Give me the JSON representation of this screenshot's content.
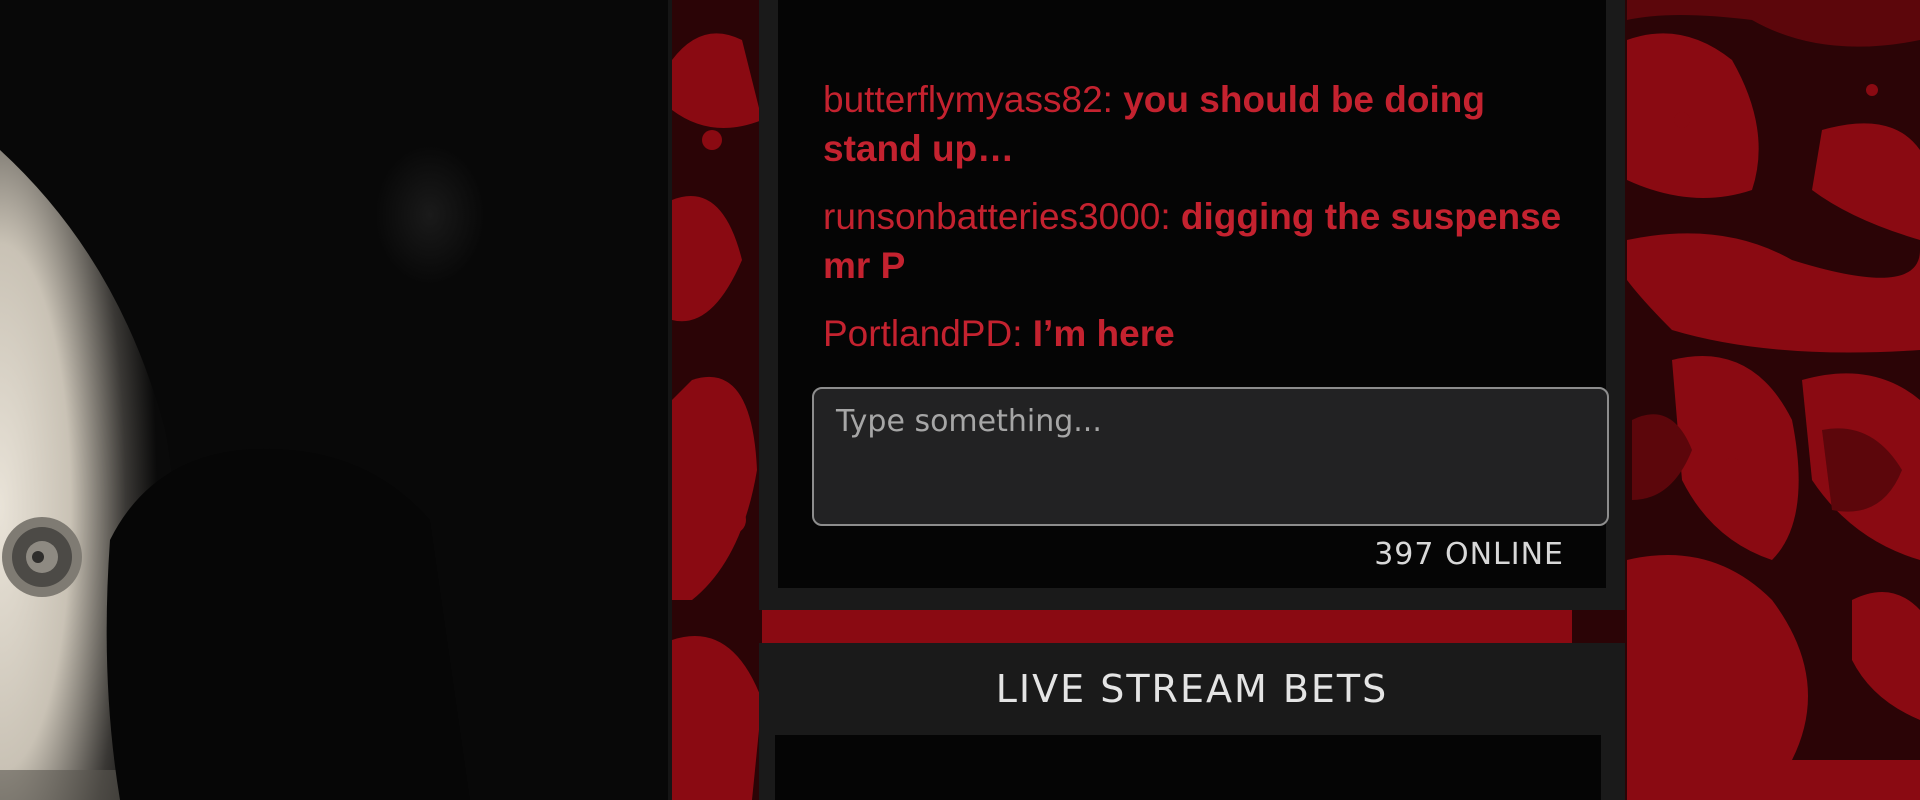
{
  "chat": {
    "messages": [
      {
        "user": "butterflymyass82:",
        "text": "you should be doing stand up…"
      },
      {
        "user": "runsonbatteries3000:",
        "text": "digging the suspense mr P"
      },
      {
        "user": "PortlandPD:",
        "text": "I’m here"
      }
    ],
    "input_placeholder": "Type something...",
    "online_count": "397 ONLINE"
  },
  "bets": {
    "title": "LIVE STREAM BETS"
  },
  "colors": {
    "chat_text": "#c4222f",
    "panel": "#1a1a1a",
    "splatter": "#8a0a12"
  },
  "icons": {
    "video_feed": "live-stream-video",
    "background": "blood-splatter"
  }
}
